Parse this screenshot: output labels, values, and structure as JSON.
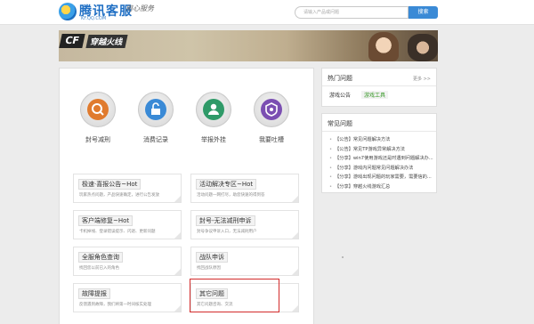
{
  "header": {
    "logo_title": "腾讯客服",
    "logo_sub": "KF.QQ.COM",
    "slogan": "用心服务",
    "search_placeholder": "请输入产品或问题",
    "search_button": "搜索"
  },
  "banner": {
    "logo_text": "CF",
    "title": "穿越火线"
  },
  "services": [
    {
      "label": "封号减刑",
      "icon": "magnifier-icon",
      "color": "#e07b2e"
    },
    {
      "label": "消费记录",
      "icon": "lock-icon",
      "color": "#3a8ad6"
    },
    {
      "label": "举报外挂",
      "icon": "user-report-icon",
      "color": "#2f9a68"
    },
    {
      "label": "我要吐槽",
      "icon": "comment-icon",
      "color": "#7b4fb2"
    }
  ],
  "tiles": [
    {
      "title": "极速·喜报公告~Hot",
      "desc": "玩家热点问题，产品快速确定，进行公告发放"
    },
    {
      "title": "活动解决专区~Hot",
      "desc": "活动问题一网打尽，助您快速的得到答"
    },
    {
      "title": "客户端修复~Hot",
      "desc": "卡机掉线、登录错误提示、闪退、更新问题"
    },
    {
      "title": "封号-无法减刑申诉",
      "desc": "封号争议申诉入口，无法减刑用户"
    },
    {
      "title": "全服角色查询",
      "desc": "找回您以前已入的角色"
    },
    {
      "title": "战队申诉",
      "desc": "找回战队原因"
    },
    {
      "title": "故障提报",
      "desc": "反馈遇到故障，我们将第一时间核实处理"
    },
    {
      "title": "其它问题",
      "desc": "其它问题咨询、交流"
    }
  ],
  "hot_questions": {
    "title": "热门问题",
    "more": "更多 >>",
    "links": [
      "游戏公告",
      "游戏工具"
    ]
  },
  "faq": {
    "title": "常见问题",
    "items": [
      "【公告】常见问题解决方法",
      "【公告】常见TP游戏异常解决方法",
      "【分享】win7使用游戏还是时遇到问题解决办...",
      "【分享】游戏内问题常见问题解决办法",
      "【分享】游戏出现问题的玩家需要，需要信的...",
      "【分享】穿越火线游戏汇总"
    ]
  }
}
